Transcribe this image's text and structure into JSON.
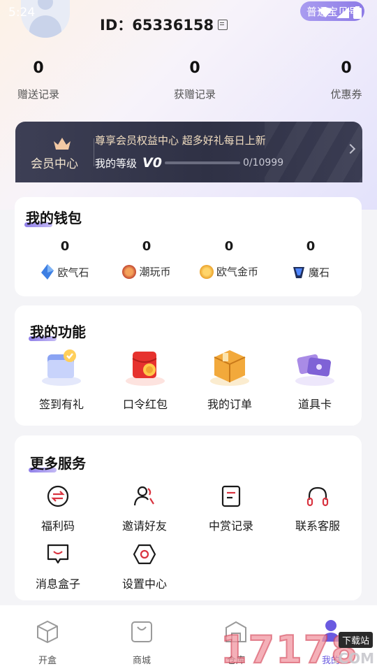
{
  "status_bar": {
    "time": "5:24"
  },
  "header": {
    "username_fragment": "···",
    "user_id": "ID：65336158",
    "member_badge": "普通宝贝号"
  },
  "stats": [
    {
      "value": "0",
      "label": "赠送记录"
    },
    {
      "value": "0",
      "label": "获赠记录"
    },
    {
      "value": "0",
      "label": "优惠券"
    }
  ],
  "vip": {
    "center_label": "会员中心",
    "title": "尊享会员权益中心 超多好礼每日上新",
    "level_label": "我的等级",
    "level_value": "V0",
    "progress_text": "0/10999",
    "progress": 0
  },
  "wallet": {
    "title": "我的钱包",
    "items": [
      {
        "value": "0",
        "label": "欧气石",
        "icon": "blue-crystal-icon"
      },
      {
        "value": "0",
        "label": "潮玩币",
        "icon": "orange-coin-icon"
      },
      {
        "value": "0",
        "label": "欧气金币",
        "icon": "gold-coin-icon"
      },
      {
        "value": "0",
        "label": "魔石",
        "icon": "dark-gem-icon"
      }
    ]
  },
  "features": {
    "title": "我的功能",
    "items": [
      {
        "label": "签到有礼",
        "icon": "calendar-checkin-icon"
      },
      {
        "label": "口令红包",
        "icon": "red-envelope-icon"
      },
      {
        "label": "我的订单",
        "icon": "package-box-icon"
      },
      {
        "label": "道具卡",
        "icon": "item-cards-icon"
      }
    ]
  },
  "services": {
    "title": "更多服务",
    "items": [
      {
        "label": "福利码",
        "icon": "exchange-icon"
      },
      {
        "label": "邀请好友",
        "icon": "invite-friends-icon"
      },
      {
        "label": "中赏记录",
        "icon": "record-document-icon"
      },
      {
        "label": "联系客服",
        "icon": "headset-icon"
      },
      {
        "label": "消息盒子",
        "icon": "message-box-icon"
      },
      {
        "label": "设置中心",
        "icon": "settings-hexagon-icon"
      }
    ]
  },
  "tabbar": [
    {
      "label": "开盒",
      "icon": "open-box-icon"
    },
    {
      "label": "商城",
      "icon": "shopping-bag-icon"
    },
    {
      "label": "仓库",
      "icon": "warehouse-icon"
    },
    {
      "label": "我的",
      "icon": "profile-icon"
    }
  ],
  "watermark": {
    "digits": "17178",
    "site": "下载站",
    "com": ".COM"
  },
  "colors": {
    "accent": "#8f7fe8",
    "vip_banner": "#2f3145",
    "vip_gold": "#f1ddc0",
    "service_red": "#d9333f",
    "tab_active": "#6a5ae0"
  }
}
